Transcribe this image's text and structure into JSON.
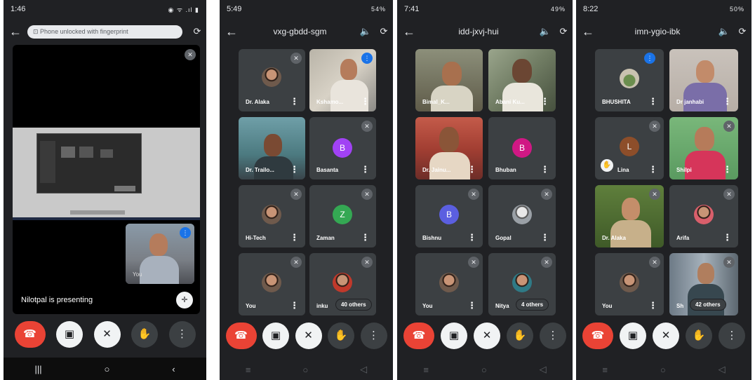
{
  "phone1": {
    "time": "1:46",
    "status_icons": "◉ ᯤ .ıl ▮",
    "notification_text": "Phone unlocked with fingerprint",
    "presenting_text": "Nilotpal is presenting",
    "self_label": "You"
  },
  "phone2": {
    "time": "5:49",
    "battery": "54%",
    "meeting_code": "vxg-gbdd-sgm",
    "participants": [
      "Dr. Alaka",
      "Kshamo...",
      "Dr. Trailo...",
      "Basanta",
      "Hi-Tech",
      "Zaman",
      "You",
      "inku"
    ],
    "avatar_letters": {
      "basanta": "B",
      "zaman": "Z"
    },
    "others_count": "40 others"
  },
  "phone3": {
    "time": "7:41",
    "battery": "49%",
    "meeting_code": "idd-jxvj-hui",
    "participants": [
      "Bimal_K...",
      "Abani Ku...",
      "Dr. Jainu...",
      "Bhuban",
      "Bishnu",
      "Gopal",
      "You",
      "Nitya"
    ],
    "avatar_letters": {
      "bhuban": "B",
      "bishnu": "B"
    },
    "others_count": "4 others"
  },
  "phone4": {
    "time": "8:22",
    "battery": "50%",
    "meeting_code": "imn-ygio-ibk",
    "participants": [
      "BHUSHITA",
      "Dr janhabi",
      "Lina",
      "Shilpi",
      "Dr. Alaka",
      "Arifa",
      "You",
      "Sh"
    ],
    "avatar_letters": {
      "lina": "L"
    },
    "others_count": "42 others"
  },
  "icons": {
    "back": "←",
    "camera_switch": "⟳",
    "speaker": "🔈",
    "mic_off": "✕",
    "more": "⋮",
    "end_call": "☎",
    "cam_off": "▣",
    "hand": "✋",
    "recents": "|||",
    "home": "○",
    "nav_back": "‹"
  },
  "colors": {
    "bg": "#202124",
    "tile": "#3c4043",
    "end_call": "#ea4335",
    "accent_blue": "#1a73e8",
    "avatar_purple": "#a142f4",
    "avatar_green": "#34a853",
    "avatar_pink": "#d01884",
    "avatar_brown": "#8d4e2a",
    "avatar_indigo": "#5b5fe0"
  }
}
